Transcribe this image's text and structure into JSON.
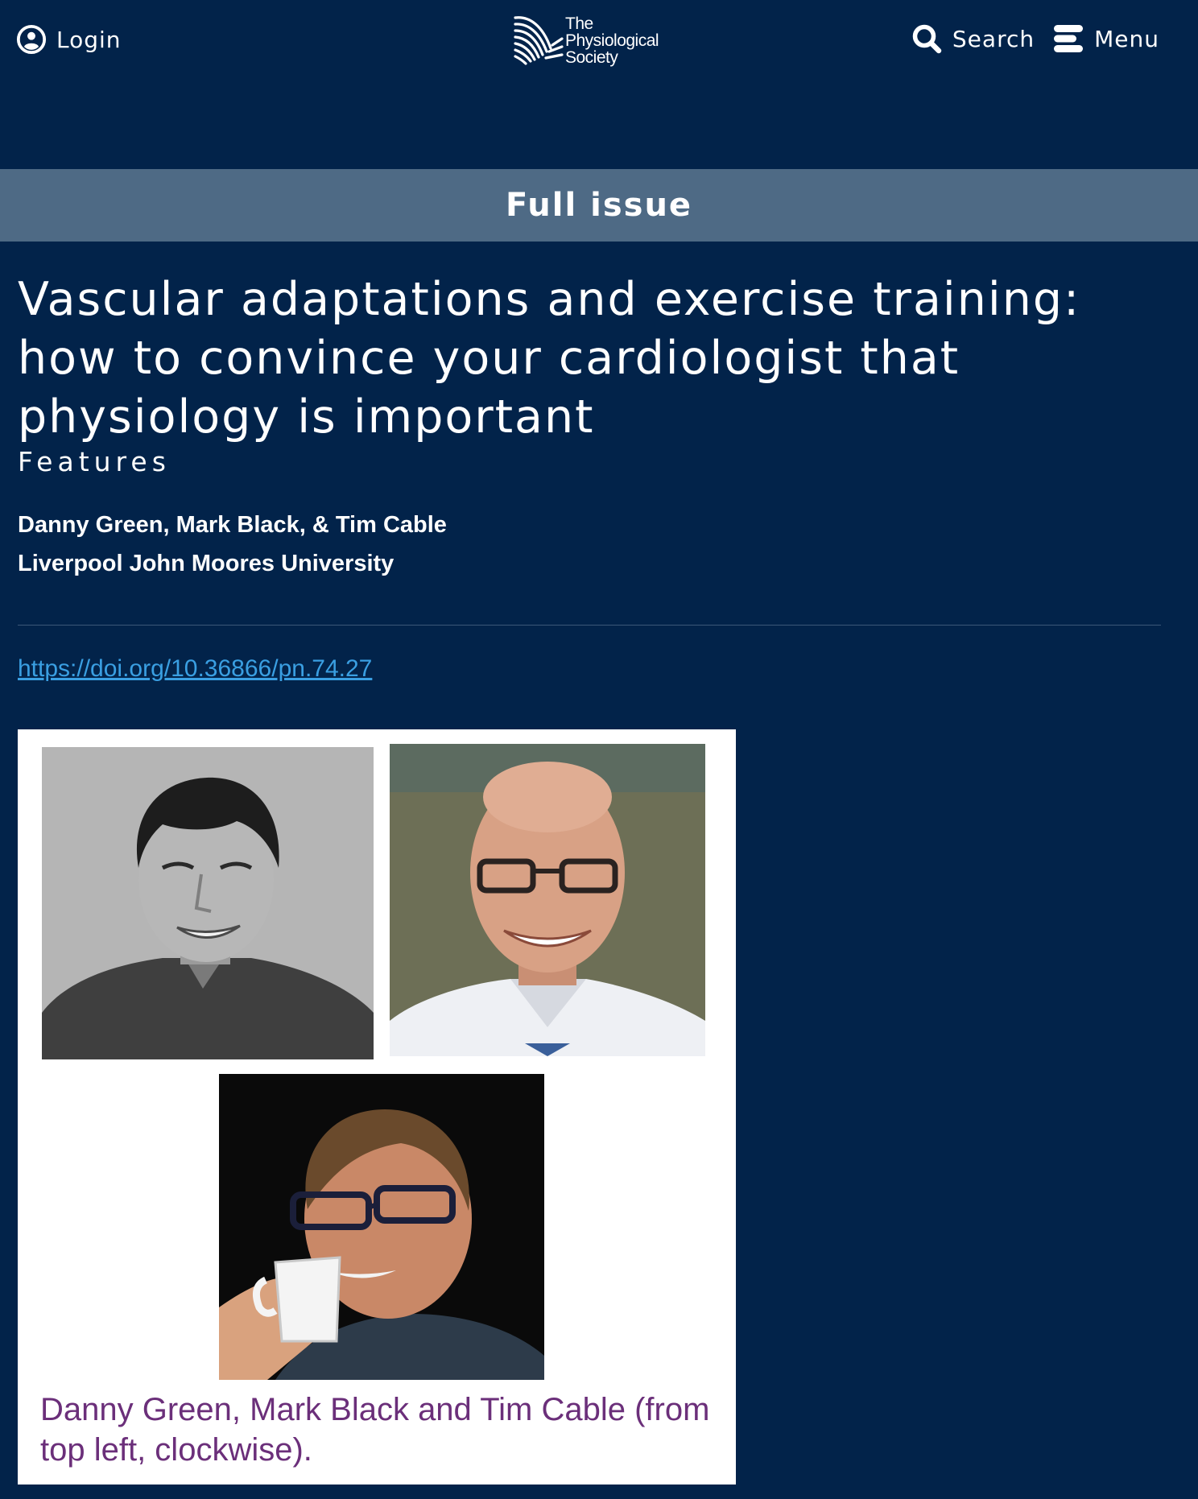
{
  "header": {
    "login_label": "Login",
    "logo_lines": [
      "The",
      "Physiological",
      "Society"
    ],
    "search_label": "Search",
    "menu_label": "Menu",
    "icons": {
      "login": "user-circle-icon",
      "search": "search-icon",
      "menu": "menu-icon"
    }
  },
  "section_band": {
    "label": "Full issue"
  },
  "article": {
    "title": "Vascular adaptations and exercise training: how to convince your cardiologist that physiology is important",
    "category": "Features",
    "authors": "Danny Green, Mark Black, & Tim Cable",
    "affiliation": "Liverpool John Moores University",
    "doi": "https://doi.org/10.36866/pn.74.27"
  },
  "figure": {
    "caption": "Danny Green, Mark Black and Tim Cable (from top left, clockwise)."
  },
  "colors": {
    "background": "#02234a",
    "band": "#4e6a85",
    "link": "#3a9fe2",
    "caption": "#6b2f7a",
    "text": "#ffffff"
  }
}
